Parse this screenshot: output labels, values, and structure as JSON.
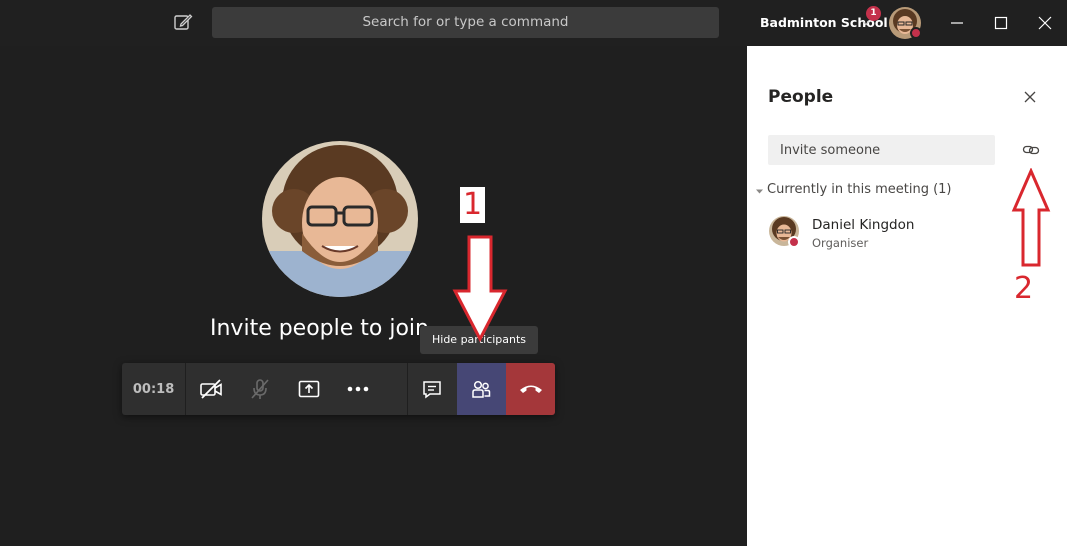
{
  "titlebar": {
    "search_placeholder": "Search for or type a command",
    "org_name": "Badminton School",
    "notification_count": "1"
  },
  "stage": {
    "invite_text": "Invite people to join",
    "timer": "00:18",
    "tooltip": "Hide participants"
  },
  "panel": {
    "title": "People",
    "invite_placeholder": "Invite someone",
    "section_label": "Currently in this meeting (1)",
    "participants": [
      {
        "name": "Daniel Kingdon",
        "role": "Organiser"
      }
    ]
  },
  "annotations": {
    "label_1": "1",
    "label_2": "2"
  },
  "colors": {
    "accent": "#464775",
    "hangup": "#a4373a",
    "presence_busy": "#c4314b",
    "annotation_red": "#d9272e"
  }
}
